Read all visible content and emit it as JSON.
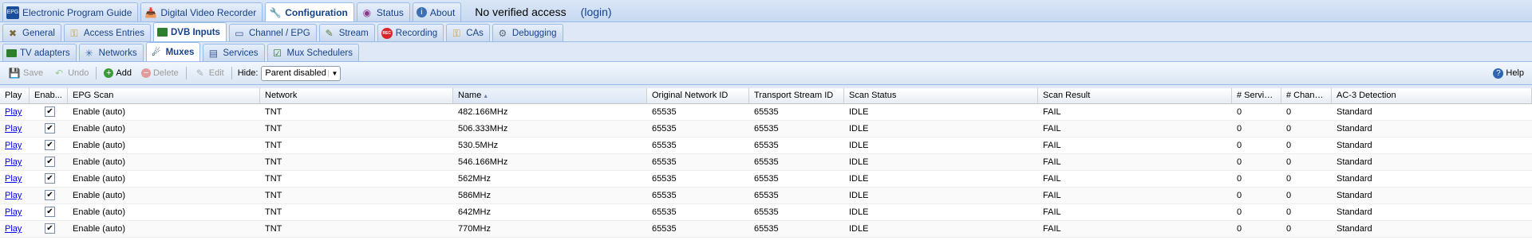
{
  "top_tabs": [
    {
      "label": "Electronic Program Guide",
      "icon": "epg-icon",
      "active": false
    },
    {
      "label": "Digital Video Recorder",
      "icon": "dvr-icon",
      "active": false
    },
    {
      "label": "Configuration",
      "icon": "wrench-icon",
      "active": true
    },
    {
      "label": "Status",
      "icon": "eye-icon",
      "active": false
    },
    {
      "label": "About",
      "icon": "info-icon",
      "active": false
    }
  ],
  "access": {
    "text": "No verified access",
    "login": "(login)"
  },
  "config_tabs": [
    {
      "label": "General",
      "icon": "tools-icon",
      "active": false
    },
    {
      "label": "Access Entries",
      "icon": "key-icon",
      "active": false
    },
    {
      "label": "DVB Inputs",
      "icon": "card-icon",
      "active": true
    },
    {
      "label": "Channel / EPG",
      "icon": "tv-icon",
      "active": false
    },
    {
      "label": "Stream",
      "icon": "stream-icon",
      "active": false
    },
    {
      "label": "Recording",
      "icon": "rec-icon",
      "active": false
    },
    {
      "label": "CAs",
      "icon": "key-icon",
      "active": false
    },
    {
      "label": "Debugging",
      "icon": "bug-icon",
      "active": false
    }
  ],
  "dvb_tabs": [
    {
      "label": "TV adapters",
      "icon": "adapter-icon",
      "active": false
    },
    {
      "label": "Networks",
      "icon": "network-icon",
      "active": false
    },
    {
      "label": "Muxes",
      "icon": "satellite-icon",
      "active": true
    },
    {
      "label": "Services",
      "icon": "services-icon",
      "active": false
    },
    {
      "label": "Mux Schedulers",
      "icon": "scheduler-icon",
      "active": false
    }
  ],
  "toolbar": {
    "save": "Save",
    "undo": "Undo",
    "add": "Add",
    "delete": "Delete",
    "edit": "Edit",
    "hide_label": "Hide:",
    "hide_value": "Parent disabled",
    "help": "Help"
  },
  "columns": [
    "Play",
    "Enab...",
    "EPG Scan",
    "Network",
    "Name",
    "Original Network ID",
    "Transport Stream ID",
    "Scan Status",
    "Scan Result",
    "# Services",
    "# Chann...",
    "AC-3 Detection"
  ],
  "sorted_column": "Name",
  "rows": [
    {
      "play": "Play",
      "enabled": true,
      "epg": "Enable (auto)",
      "network": "TNT",
      "name": "482.166MHz",
      "onid": "65535",
      "tsid": "65535",
      "status": "IDLE",
      "result": "FAIL",
      "services": "0",
      "channels": "0",
      "ac3": "Standard"
    },
    {
      "play": "Play",
      "enabled": true,
      "epg": "Enable (auto)",
      "network": "TNT",
      "name": "506.333MHz",
      "onid": "65535",
      "tsid": "65535",
      "status": "IDLE",
      "result": "FAIL",
      "services": "0",
      "channels": "0",
      "ac3": "Standard"
    },
    {
      "play": "Play",
      "enabled": true,
      "epg": "Enable (auto)",
      "network": "TNT",
      "name": "530.5MHz",
      "onid": "65535",
      "tsid": "65535",
      "status": "IDLE",
      "result": "FAIL",
      "services": "0",
      "channels": "0",
      "ac3": "Standard"
    },
    {
      "play": "Play",
      "enabled": true,
      "epg": "Enable (auto)",
      "network": "TNT",
      "name": "546.166MHz",
      "onid": "65535",
      "tsid": "65535",
      "status": "IDLE",
      "result": "FAIL",
      "services": "0",
      "channels": "0",
      "ac3": "Standard"
    },
    {
      "play": "Play",
      "enabled": true,
      "epg": "Enable (auto)",
      "network": "TNT",
      "name": "562MHz",
      "onid": "65535",
      "tsid": "65535",
      "status": "IDLE",
      "result": "FAIL",
      "services": "0",
      "channels": "0",
      "ac3": "Standard"
    },
    {
      "play": "Play",
      "enabled": true,
      "epg": "Enable (auto)",
      "network": "TNT",
      "name": "586MHz",
      "onid": "65535",
      "tsid": "65535",
      "status": "IDLE",
      "result": "FAIL",
      "services": "0",
      "channels": "0",
      "ac3": "Standard"
    },
    {
      "play": "Play",
      "enabled": true,
      "epg": "Enable (auto)",
      "network": "TNT",
      "name": "642MHz",
      "onid": "65535",
      "tsid": "65535",
      "status": "IDLE",
      "result": "FAIL",
      "services": "0",
      "channels": "0",
      "ac3": "Standard"
    },
    {
      "play": "Play",
      "enabled": true,
      "epg": "Enable (auto)",
      "network": "TNT",
      "name": "770MHz",
      "onid": "65535",
      "tsid": "65535",
      "status": "IDLE",
      "result": "FAIL",
      "services": "0",
      "channels": "0",
      "ac3": "Standard"
    }
  ]
}
